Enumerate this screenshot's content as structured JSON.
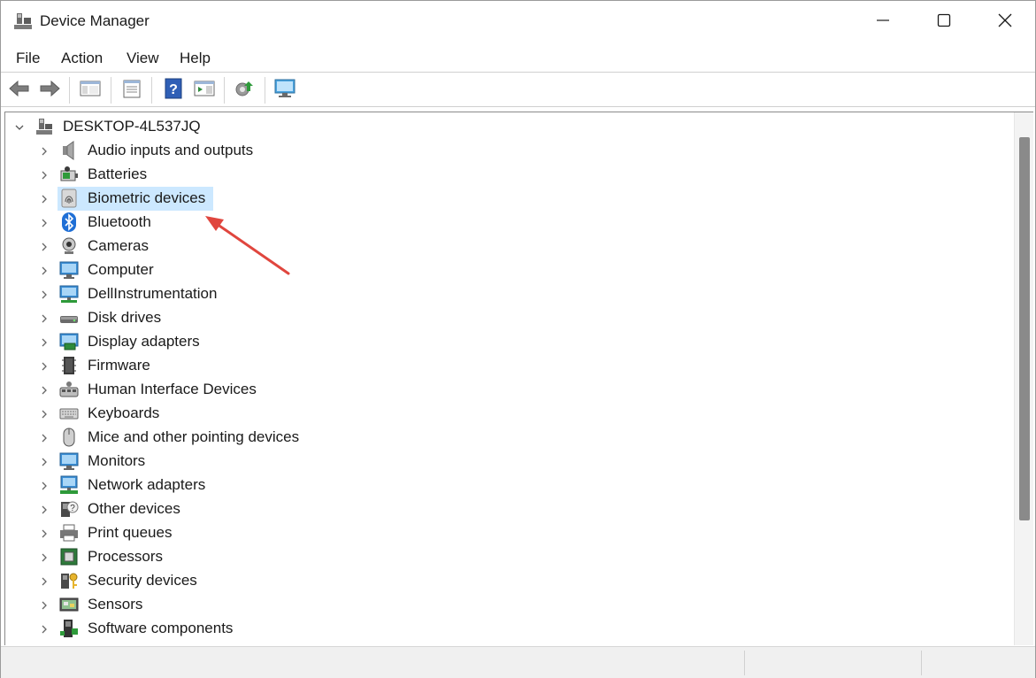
{
  "window": {
    "title": "Device Manager",
    "controls": {
      "minimize": "minimize-icon",
      "maximize": "maximize-icon",
      "close": "close-icon"
    }
  },
  "menu": {
    "items": [
      {
        "label": "File"
      },
      {
        "label": "Action"
      },
      {
        "label": "View"
      },
      {
        "label": "Help"
      }
    ]
  },
  "toolbar": {
    "buttons": [
      {
        "icon": "back-arrow-icon"
      },
      {
        "icon": "forward-arrow-icon"
      },
      {
        "icon": "show-hide-console-tree-icon"
      },
      {
        "icon": "properties-icon"
      },
      {
        "icon": "help-icon"
      },
      {
        "icon": "action-pane-icon"
      },
      {
        "icon": "update-driver-icon"
      },
      {
        "icon": "scan-hardware-changes-icon"
      }
    ]
  },
  "tree": {
    "root": {
      "label": "DESKTOP-4L537JQ",
      "expanded": true,
      "icon": "computer-root-icon"
    },
    "categories": [
      {
        "label": "Audio inputs and outputs",
        "icon": "speaker-icon"
      },
      {
        "label": "Batteries",
        "icon": "battery-icon"
      },
      {
        "label": "Biometric devices",
        "icon": "fingerprint-icon",
        "selected": true
      },
      {
        "label": "Bluetooth",
        "icon": "bluetooth-icon"
      },
      {
        "label": "Cameras",
        "icon": "camera-icon"
      },
      {
        "label": "Computer",
        "icon": "monitor-icon"
      },
      {
        "label": "DellInstrumentation",
        "icon": "network-monitor-icon"
      },
      {
        "label": "Disk drives",
        "icon": "disk-drive-icon"
      },
      {
        "label": "Display adapters",
        "icon": "display-adapter-icon"
      },
      {
        "label": "Firmware",
        "icon": "firmware-chip-icon"
      },
      {
        "label": "Human Interface Devices",
        "icon": "hid-icon"
      },
      {
        "label": "Keyboards",
        "icon": "keyboard-icon"
      },
      {
        "label": "Mice and other pointing devices",
        "icon": "mouse-icon"
      },
      {
        "label": "Monitors",
        "icon": "monitor-icon"
      },
      {
        "label": "Network adapters",
        "icon": "network-adapter-icon"
      },
      {
        "label": "Other devices",
        "icon": "unknown-device-icon"
      },
      {
        "label": "Print queues",
        "icon": "printer-icon"
      },
      {
        "label": "Processors",
        "icon": "processor-icon"
      },
      {
        "label": "Security devices",
        "icon": "security-key-icon"
      },
      {
        "label": "Sensors",
        "icon": "sensor-icon"
      },
      {
        "label": "Software components",
        "icon": "software-component-icon"
      }
    ]
  },
  "colors": {
    "selection": "#cce8ff",
    "annotation_arrow": "#e0463e",
    "scroll_thumb": "#8a8a8a"
  }
}
